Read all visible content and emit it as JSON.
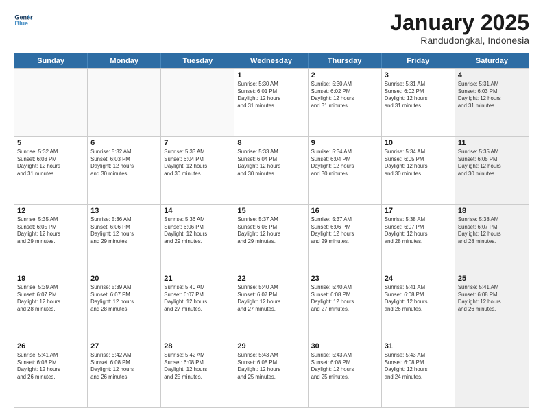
{
  "header": {
    "logo_line1": "General",
    "logo_line2": "Blue",
    "month": "January 2025",
    "location": "Randudongkal, Indonesia"
  },
  "weekdays": [
    "Sunday",
    "Monday",
    "Tuesday",
    "Wednesday",
    "Thursday",
    "Friday",
    "Saturday"
  ],
  "rows": [
    [
      {
        "day": "",
        "info": "",
        "shaded": false,
        "empty": true
      },
      {
        "day": "",
        "info": "",
        "shaded": false,
        "empty": true
      },
      {
        "day": "",
        "info": "",
        "shaded": false,
        "empty": true
      },
      {
        "day": "1",
        "info": "Sunrise: 5:30 AM\nSunset: 6:01 PM\nDaylight: 12 hours\nand 31 minutes.",
        "shaded": false,
        "empty": false
      },
      {
        "day": "2",
        "info": "Sunrise: 5:30 AM\nSunset: 6:02 PM\nDaylight: 12 hours\nand 31 minutes.",
        "shaded": false,
        "empty": false
      },
      {
        "day": "3",
        "info": "Sunrise: 5:31 AM\nSunset: 6:02 PM\nDaylight: 12 hours\nand 31 minutes.",
        "shaded": false,
        "empty": false
      },
      {
        "day": "4",
        "info": "Sunrise: 5:31 AM\nSunset: 6:03 PM\nDaylight: 12 hours\nand 31 minutes.",
        "shaded": true,
        "empty": false
      }
    ],
    [
      {
        "day": "5",
        "info": "Sunrise: 5:32 AM\nSunset: 6:03 PM\nDaylight: 12 hours\nand 31 minutes.",
        "shaded": false,
        "empty": false
      },
      {
        "day": "6",
        "info": "Sunrise: 5:32 AM\nSunset: 6:03 PM\nDaylight: 12 hours\nand 30 minutes.",
        "shaded": false,
        "empty": false
      },
      {
        "day": "7",
        "info": "Sunrise: 5:33 AM\nSunset: 6:04 PM\nDaylight: 12 hours\nand 30 minutes.",
        "shaded": false,
        "empty": false
      },
      {
        "day": "8",
        "info": "Sunrise: 5:33 AM\nSunset: 6:04 PM\nDaylight: 12 hours\nand 30 minutes.",
        "shaded": false,
        "empty": false
      },
      {
        "day": "9",
        "info": "Sunrise: 5:34 AM\nSunset: 6:04 PM\nDaylight: 12 hours\nand 30 minutes.",
        "shaded": false,
        "empty": false
      },
      {
        "day": "10",
        "info": "Sunrise: 5:34 AM\nSunset: 6:05 PM\nDaylight: 12 hours\nand 30 minutes.",
        "shaded": false,
        "empty": false
      },
      {
        "day": "11",
        "info": "Sunrise: 5:35 AM\nSunset: 6:05 PM\nDaylight: 12 hours\nand 30 minutes.",
        "shaded": true,
        "empty": false
      }
    ],
    [
      {
        "day": "12",
        "info": "Sunrise: 5:35 AM\nSunset: 6:05 PM\nDaylight: 12 hours\nand 29 minutes.",
        "shaded": false,
        "empty": false
      },
      {
        "day": "13",
        "info": "Sunrise: 5:36 AM\nSunset: 6:06 PM\nDaylight: 12 hours\nand 29 minutes.",
        "shaded": false,
        "empty": false
      },
      {
        "day": "14",
        "info": "Sunrise: 5:36 AM\nSunset: 6:06 PM\nDaylight: 12 hours\nand 29 minutes.",
        "shaded": false,
        "empty": false
      },
      {
        "day": "15",
        "info": "Sunrise: 5:37 AM\nSunset: 6:06 PM\nDaylight: 12 hours\nand 29 minutes.",
        "shaded": false,
        "empty": false
      },
      {
        "day": "16",
        "info": "Sunrise: 5:37 AM\nSunset: 6:06 PM\nDaylight: 12 hours\nand 29 minutes.",
        "shaded": false,
        "empty": false
      },
      {
        "day": "17",
        "info": "Sunrise: 5:38 AM\nSunset: 6:07 PM\nDaylight: 12 hours\nand 28 minutes.",
        "shaded": false,
        "empty": false
      },
      {
        "day": "18",
        "info": "Sunrise: 5:38 AM\nSunset: 6:07 PM\nDaylight: 12 hours\nand 28 minutes.",
        "shaded": true,
        "empty": false
      }
    ],
    [
      {
        "day": "19",
        "info": "Sunrise: 5:39 AM\nSunset: 6:07 PM\nDaylight: 12 hours\nand 28 minutes.",
        "shaded": false,
        "empty": false
      },
      {
        "day": "20",
        "info": "Sunrise: 5:39 AM\nSunset: 6:07 PM\nDaylight: 12 hours\nand 28 minutes.",
        "shaded": false,
        "empty": false
      },
      {
        "day": "21",
        "info": "Sunrise: 5:40 AM\nSunset: 6:07 PM\nDaylight: 12 hours\nand 27 minutes.",
        "shaded": false,
        "empty": false
      },
      {
        "day": "22",
        "info": "Sunrise: 5:40 AM\nSunset: 6:07 PM\nDaylight: 12 hours\nand 27 minutes.",
        "shaded": false,
        "empty": false
      },
      {
        "day": "23",
        "info": "Sunrise: 5:40 AM\nSunset: 6:08 PM\nDaylight: 12 hours\nand 27 minutes.",
        "shaded": false,
        "empty": false
      },
      {
        "day": "24",
        "info": "Sunrise: 5:41 AM\nSunset: 6:08 PM\nDaylight: 12 hours\nand 26 minutes.",
        "shaded": false,
        "empty": false
      },
      {
        "day": "25",
        "info": "Sunrise: 5:41 AM\nSunset: 6:08 PM\nDaylight: 12 hours\nand 26 minutes.",
        "shaded": true,
        "empty": false
      }
    ],
    [
      {
        "day": "26",
        "info": "Sunrise: 5:41 AM\nSunset: 6:08 PM\nDaylight: 12 hours\nand 26 minutes.",
        "shaded": false,
        "empty": false
      },
      {
        "day": "27",
        "info": "Sunrise: 5:42 AM\nSunset: 6:08 PM\nDaylight: 12 hours\nand 26 minutes.",
        "shaded": false,
        "empty": false
      },
      {
        "day": "28",
        "info": "Sunrise: 5:42 AM\nSunset: 6:08 PM\nDaylight: 12 hours\nand 25 minutes.",
        "shaded": false,
        "empty": false
      },
      {
        "day": "29",
        "info": "Sunrise: 5:43 AM\nSunset: 6:08 PM\nDaylight: 12 hours\nand 25 minutes.",
        "shaded": false,
        "empty": false
      },
      {
        "day": "30",
        "info": "Sunrise: 5:43 AM\nSunset: 6:08 PM\nDaylight: 12 hours\nand 25 minutes.",
        "shaded": false,
        "empty": false
      },
      {
        "day": "31",
        "info": "Sunrise: 5:43 AM\nSunset: 6:08 PM\nDaylight: 12 hours\nand 24 minutes.",
        "shaded": false,
        "empty": false
      },
      {
        "day": "",
        "info": "",
        "shaded": true,
        "empty": true
      }
    ]
  ]
}
